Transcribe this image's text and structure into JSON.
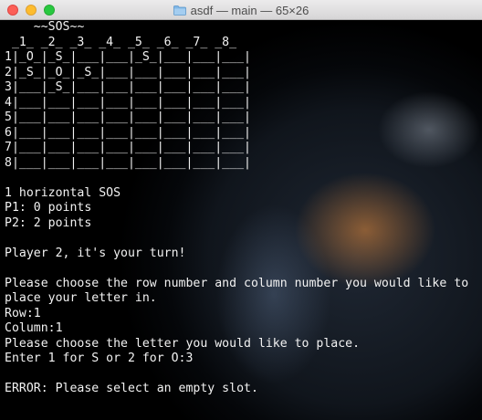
{
  "window": {
    "title": "asdf — main — 65×26",
    "controls": [
      "close",
      "minimize",
      "zoom"
    ],
    "title_icon": "folder-icon"
  },
  "terminal": {
    "lines": [
      "    ~~SOS~~",
      " _1_ _2_ _3_ _4_ _5_ _6_ _7_ _8_",
      "1|_O_|_S_|___|___|_S_|___|___|___|",
      "2|_S_|_O_|_S_|___|___|___|___|___|",
      "3|___|_S_|___|___|___|___|___|___|",
      "4|___|___|___|___|___|___|___|___|",
      "5|___|___|___|___|___|___|___|___|",
      "6|___|___|___|___|___|___|___|___|",
      "7|___|___|___|___|___|___|___|___|",
      "8|___|___|___|___|___|___|___|___|",
      "",
      "1 horizontal SOS",
      "P1: 0 points",
      "P2: 2 points",
      "",
      "Player 2, it's your turn!",
      "",
      "Please choose the row number and column number you would like to",
      "place your letter in.",
      "Row:1",
      "Column:1",
      "Please choose the letter you would like to place.",
      "Enter 1 for S or 2 for O:3",
      "",
      "ERROR: Please select an empty slot."
    ]
  },
  "colors": {
    "text": "#f2f2f2",
    "background": "#000000",
    "close": "#fc5f57",
    "minimize": "#fdbc2e",
    "zoom": "#28c840"
  }
}
